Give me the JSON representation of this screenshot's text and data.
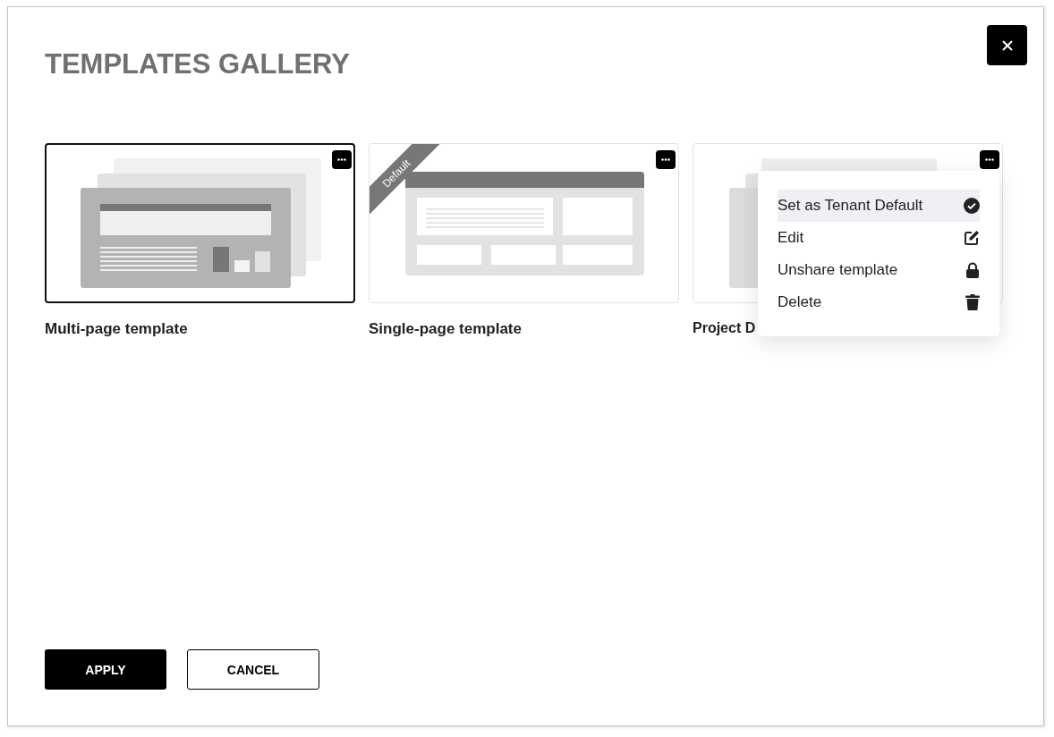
{
  "dialog": {
    "title": "TEMPLATES GALLERY"
  },
  "templates": [
    {
      "name": "Multi-page template",
      "kind": "multi",
      "selected": true
    },
    {
      "name": "Single-page template",
      "kind": "single",
      "selected": false,
      "badge": "Default"
    },
    {
      "name": "Project D",
      "kind": "project",
      "selected": false,
      "menu_open": true
    }
  ],
  "menu": [
    {
      "label": "Set as Tenant Default",
      "kind": "check",
      "selected": true
    },
    {
      "label": "Edit",
      "kind": "edit",
      "selected": false
    },
    {
      "label": "Unshare template",
      "kind": "lock",
      "selected": false
    },
    {
      "label": "Delete",
      "kind": "trash",
      "selected": false
    }
  ],
  "buttons": [
    {
      "label": "APPLY",
      "kind": "primary"
    },
    {
      "label": "CANCEL",
      "kind": "secondary"
    }
  ]
}
